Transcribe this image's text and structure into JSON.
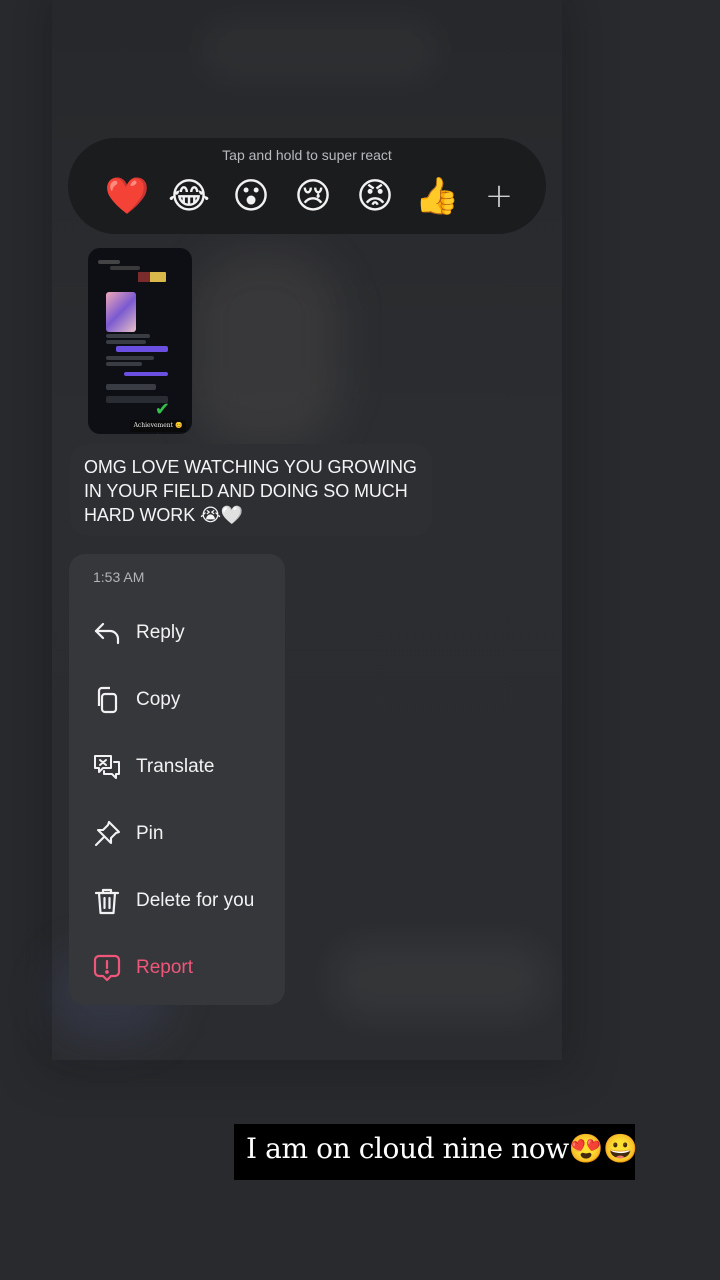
{
  "reactions": {
    "hint": "Tap and hold to super react",
    "emojis": [
      "❤️",
      "😂",
      "😮",
      "😢",
      "😡",
      "👍"
    ],
    "plus": "+"
  },
  "shared_post": {
    "caption": "Achievement 😊🔥"
  },
  "message": {
    "text": "OMG LOVE WATCHING YOU GROWING IN YOUR FIELD AND DOING SO MUCH HARD WORK 😭🤍"
  },
  "context_menu": {
    "time": "1:53 AM",
    "items": [
      {
        "label": "Reply",
        "icon": "reply-icon"
      },
      {
        "label": "Copy",
        "icon": "copy-icon"
      },
      {
        "label": "Translate",
        "icon": "translate-icon"
      },
      {
        "label": "Pin",
        "icon": "pin-icon"
      },
      {
        "label": "Delete for you",
        "icon": "trash-icon"
      },
      {
        "label": "Report",
        "icon": "report-icon",
        "color": "#f0567a"
      }
    ]
  },
  "overlay_caption": {
    "text": "I am on cloud nine now😍😀"
  },
  "colors": {
    "background": "#282a2d",
    "menu": "#35373b",
    "danger": "#f0567a",
    "check": "#35c04a"
  }
}
